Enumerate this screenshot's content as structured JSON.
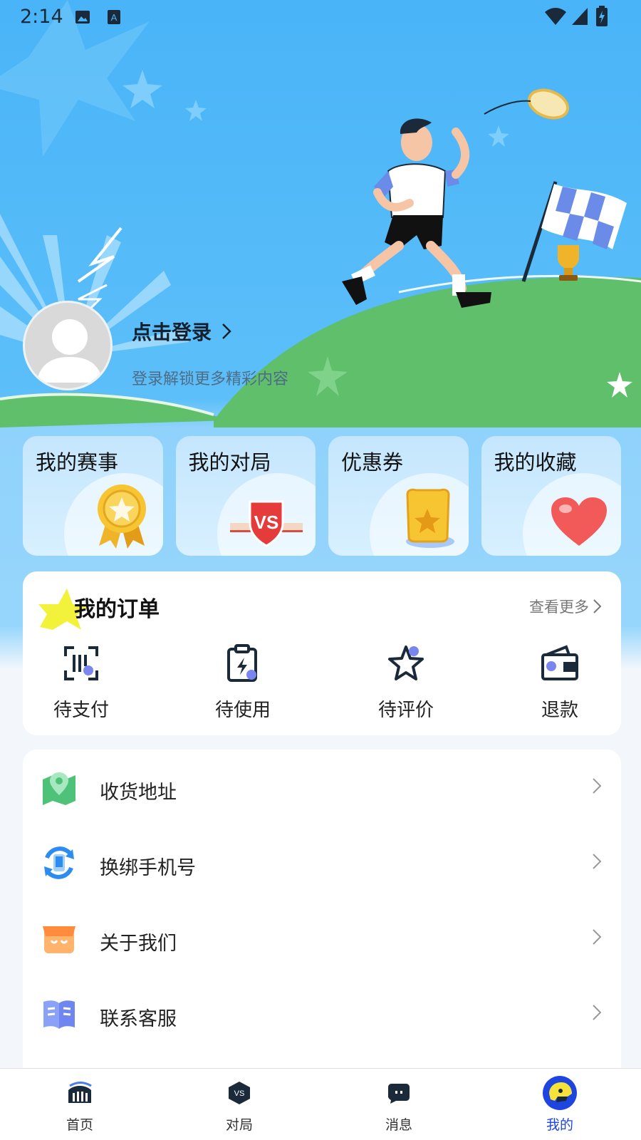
{
  "status_bar": {
    "time": "2:14"
  },
  "profile": {
    "login_label": "点击登录",
    "subtitle": "登录解锁更多精彩内容"
  },
  "quick_cards": [
    {
      "label": "我的赛事",
      "icon": "medal-icon"
    },
    {
      "label": "我的对局",
      "icon": "vs-badge-icon"
    },
    {
      "label": "优惠券",
      "icon": "coupon-ticket-icon"
    },
    {
      "label": "我的收藏",
      "icon": "heart-icon"
    }
  ],
  "orders": {
    "title": "我的订单",
    "more_label": "查看更多",
    "items": [
      {
        "label": "待支付",
        "icon": "scan-pay-icon"
      },
      {
        "label": "待使用",
        "icon": "clipboard-bolt-icon"
      },
      {
        "label": "待评价",
        "icon": "star-outline-icon"
      },
      {
        "label": "退款",
        "icon": "wallet-icon"
      }
    ]
  },
  "menu": [
    {
      "label": "收货地址",
      "icon": "map-pin-icon"
    },
    {
      "label": "换绑手机号",
      "icon": "phone-swap-icon"
    },
    {
      "label": "关于我们",
      "icon": "store-icon"
    },
    {
      "label": "联系客服",
      "icon": "book-icon"
    }
  ],
  "tabbar": [
    {
      "label": "首页",
      "icon": "stadium-icon",
      "active": false
    },
    {
      "label": "对局",
      "icon": "vs-shield-icon",
      "active": false
    },
    {
      "label": "消息",
      "icon": "chat-bubble-icon",
      "active": false
    },
    {
      "label": "我的",
      "icon": "helmet-icon",
      "active": true
    }
  ],
  "colors": {
    "hero_blue": "#49b4f8",
    "grass_green": "#5fbf6a",
    "accent_blue": "#1f45e0",
    "icon_dark": "#1b2a3a",
    "icon_dot": "#7a86f0"
  }
}
